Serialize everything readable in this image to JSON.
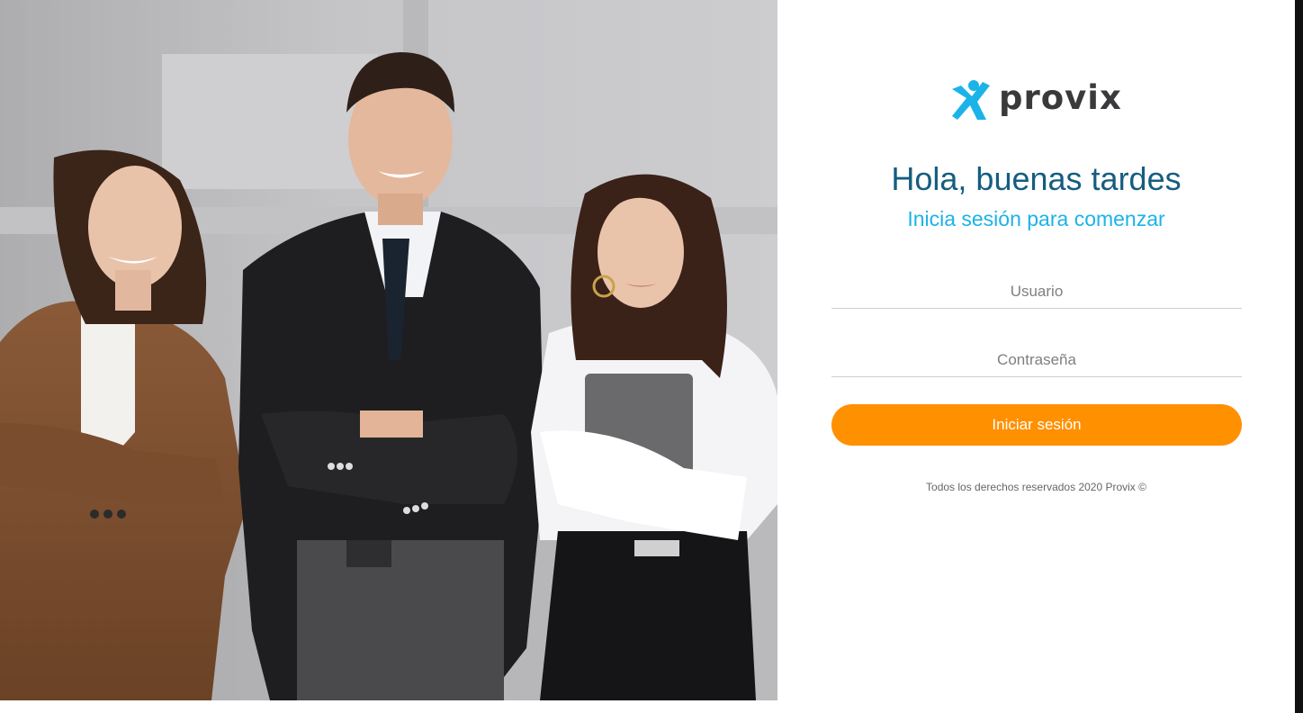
{
  "brand": {
    "name": "provix",
    "logo_icon": "runner-icon",
    "accent_color": "#1bb3e8",
    "text_color": "#3a3a3c"
  },
  "hero": {
    "image": "three-business-people-photo"
  },
  "login": {
    "greeting": "Hola, buenas tardes",
    "subtitle": "Inicia sesión para comenzar",
    "username_placeholder": "Usuario",
    "username_value": "",
    "password_placeholder": "Contraseña",
    "password_value": "",
    "submit_label": "Iniciar sesión",
    "button_color": "#ff9000"
  },
  "footer": {
    "copyright": "Todos los derechos reservados 2020 Provix ©"
  }
}
